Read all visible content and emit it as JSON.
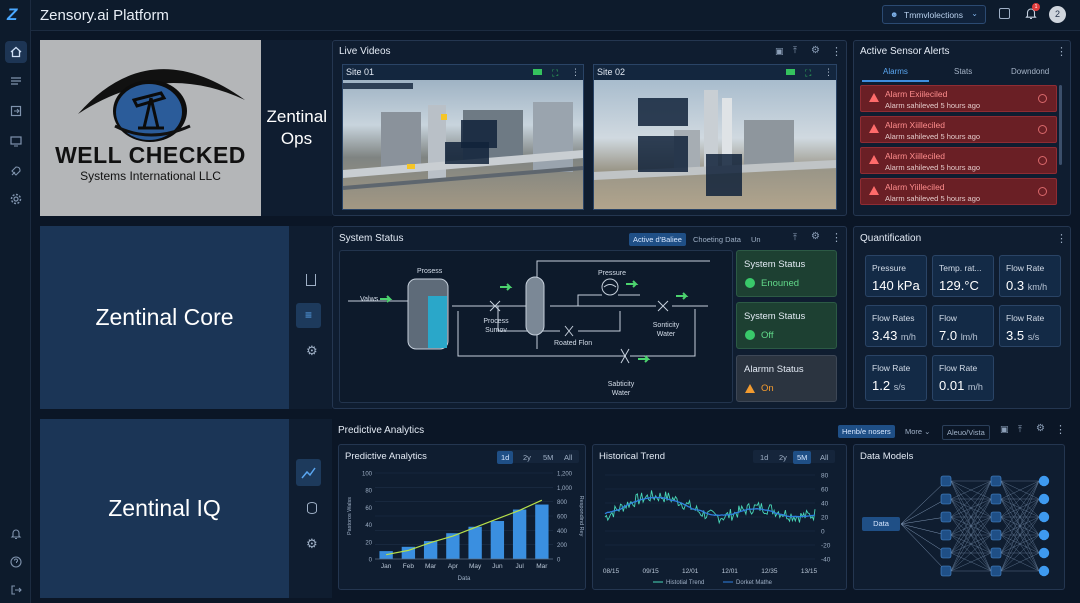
{
  "app": {
    "title": "Zensory.ai Platform",
    "logo_letter": "Z",
    "user_initial": "2",
    "notif_count": "1",
    "selector_label": "Tmmvlolections"
  },
  "sidebar": {
    "icons": [
      "home-icon",
      "list-icon",
      "export-icon",
      "monitor-icon",
      "rocket-icon",
      "gear-icon"
    ],
    "bottom_icons": [
      "bell-icon",
      "help-icon",
      "logout-icon"
    ]
  },
  "rows": [
    {
      "title": "Zentinal Ops",
      "logo": {
        "line1": "WELL CHECKED",
        "line2": "Systems International LLC"
      }
    },
    {
      "title": "Zentinal Core"
    },
    {
      "title": "Zentinal IQ"
    }
  ],
  "live_videos": {
    "title": "Live Videos",
    "feeds": [
      {
        "label": "Site 01"
      },
      {
        "label": "Site 02"
      }
    ]
  },
  "alerts": {
    "title": "Active Sensor Alerts",
    "tabs": [
      "Alarms",
      "Stats",
      "Downdond"
    ],
    "items": [
      {
        "title": "Alarm Exiileciled",
        "sub": "Alarm sahileved 5 hours ago"
      },
      {
        "title": "Alarm Xiilleciled",
        "sub": "Alarm sahileved 5 hours ago"
      },
      {
        "title": "Alarm Xiilleciled",
        "sub": "Alarm sahileved 5 hours ago"
      },
      {
        "title": "Alarm Yiilleciled",
        "sub": "Alarm sahileved 5 hours ago"
      }
    ]
  },
  "system_status": {
    "title": "System Status",
    "tabs": [
      "Active d'Baliee",
      "Choeting Data",
      "Un"
    ],
    "diagram": {
      "input": "Valws",
      "tank": "Prosess",
      "valve1": "Process Sumov",
      "pressure": "Pressure",
      "valve2": "Roated Flon",
      "valve3": "Sonticity Water",
      "valve4": "Sabticity Water"
    },
    "cards": [
      {
        "label": "System Status",
        "value": "Enouned",
        "state": "ok"
      },
      {
        "label": "System Status",
        "value": "Off",
        "state": "ok"
      },
      {
        "label": "Alarmn Status",
        "value": "On",
        "state": "warn"
      }
    ]
  },
  "quantification": {
    "title": "Quantification",
    "cards": [
      {
        "label": "Pressure",
        "value": "140 kPa",
        "unit": ""
      },
      {
        "label": "Temp. rat...",
        "value": "129.°C",
        "unit": ""
      },
      {
        "label": "Flow Rate",
        "value": "0.3",
        "unit": "km/h"
      },
      {
        "label": "Flow Rates",
        "value": "3.43",
        "unit": "m/h"
      },
      {
        "label": "Flow",
        "value": "7.0",
        "unit": "lm/h"
      },
      {
        "label": "Flow Rate",
        "value": "3.5",
        "unit": "s/s"
      },
      {
        "label": "Flow Rate",
        "value": "1.2",
        "unit": "s/s"
      },
      {
        "label": "Flow Rate",
        "value": "0.01",
        "unit": "m/h"
      }
    ]
  },
  "predictive": {
    "title": "Predictive Analytics",
    "header_tabs": [
      "Henb/e nosers",
      "More",
      "Aleuo/Vista"
    ]
  },
  "chart_data": [
    {
      "type": "bar",
      "title": "Predictive Analytics",
      "range_tabs": [
        "1d",
        "2y",
        "5M",
        "All"
      ],
      "active_tab": "1d",
      "categories": [
        "Jan",
        "Feb",
        "Mar",
        "Apr",
        "May",
        "Jun",
        "Jul",
        "Mar"
      ],
      "values": [
        110,
        170,
        250,
        360,
        450,
        530,
        690,
        760
      ],
      "trend": [
        60,
        120,
        230,
        320,
        440,
        560,
        680,
        820
      ],
      "ylim": [
        0,
        1200
      ],
      "yticks_left": [
        0,
        20,
        40,
        60,
        80,
        100
      ],
      "yticks_right": [
        0,
        200,
        400,
        600,
        800,
        1000,
        1200
      ],
      "xlabel": "Data",
      "ylabel": "Pastoros Walss",
      "y2label": "Respondind Rey"
    },
    {
      "type": "line",
      "title": "Historical Trend",
      "range_tabs": [
        "1d",
        "2y",
        "5M",
        "All"
      ],
      "active_tab": "5M",
      "x": [
        "08/15",
        "09/15",
        "12/01",
        "12/01",
        "12/35",
        "13/15"
      ],
      "ylim": [
        -40,
        80
      ],
      "yticks_right": [
        -40,
        -20,
        0,
        20,
        40,
        60,
        80
      ],
      "series": [
        {
          "name": "Histotial Trend"
        },
        {
          "name": "Dorket Mathe"
        }
      ]
    },
    {
      "type": "diagram",
      "title": "Data Models",
      "input": "Data"
    }
  ]
}
